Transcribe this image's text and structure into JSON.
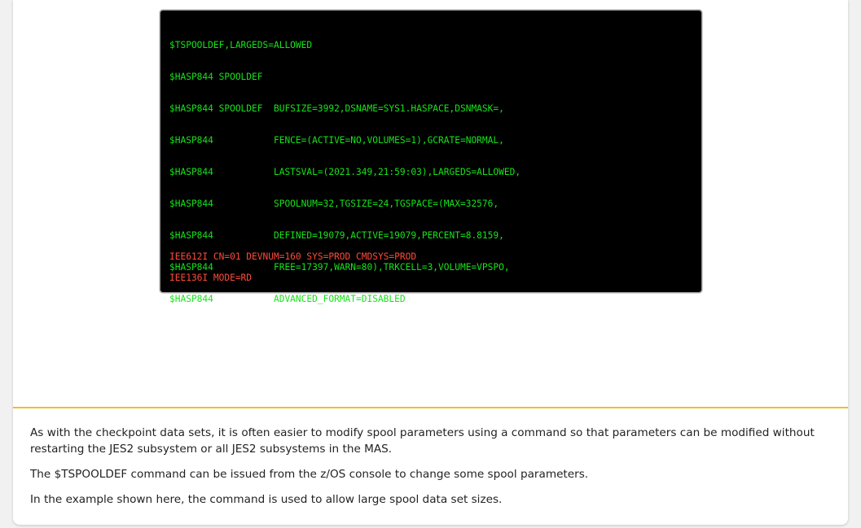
{
  "terminal": {
    "lines": [
      "$TSPOOLDEF,LARGEDS=ALLOWED",
      "$HASP844 SPOOLDEF",
      "$HASP844 SPOOLDEF  BUFSIZE=3992,DSNAME=SYS1.HASPACE,DSNMASK=,",
      "$HASP844           FENCE=(ACTIVE=NO,VOLUMES=1),GCRATE=NORMAL,",
      "$HASP844           LASTSVAL=(2021.349,21:59:03),LARGEDS=ALLOWED,",
      "$HASP844           SPOOLNUM=32,TGSIZE=24,TGSPACE=(MAX=32576,",
      "$HASP844           DEFINED=19079,ACTIVE=19079,PERCENT=8.8159,",
      "$HASP844           FREE=17397,WARN=80),TRKCELL=3,VOLUME=VPSPO,",
      "$HASP844           ADVANCED_FORMAT=DISABLED"
    ],
    "message1": "IEE612I CN=01 DEVNUM=160 SYS=PROD CMDSYS=PROD",
    "message2": "IEE136I MODE=RD",
    "text_color": "#16e31a",
    "message_color": "#ff4a3a"
  },
  "body": {
    "paragraph1": "As with the checkpoint data sets, it is often easier to modify spool parameters using a command so that parameters can be modified without restarting the JES2 subsystem or all JES2 subsystems in the MAS.",
    "paragraph2": "The $TSPOOLDEF command can be issued from the z/OS console to change some spool parameters.",
    "paragraph3": "In the example shown here, the command is used to allow large spool data set sizes."
  },
  "accent_color": "#f2bd2a"
}
